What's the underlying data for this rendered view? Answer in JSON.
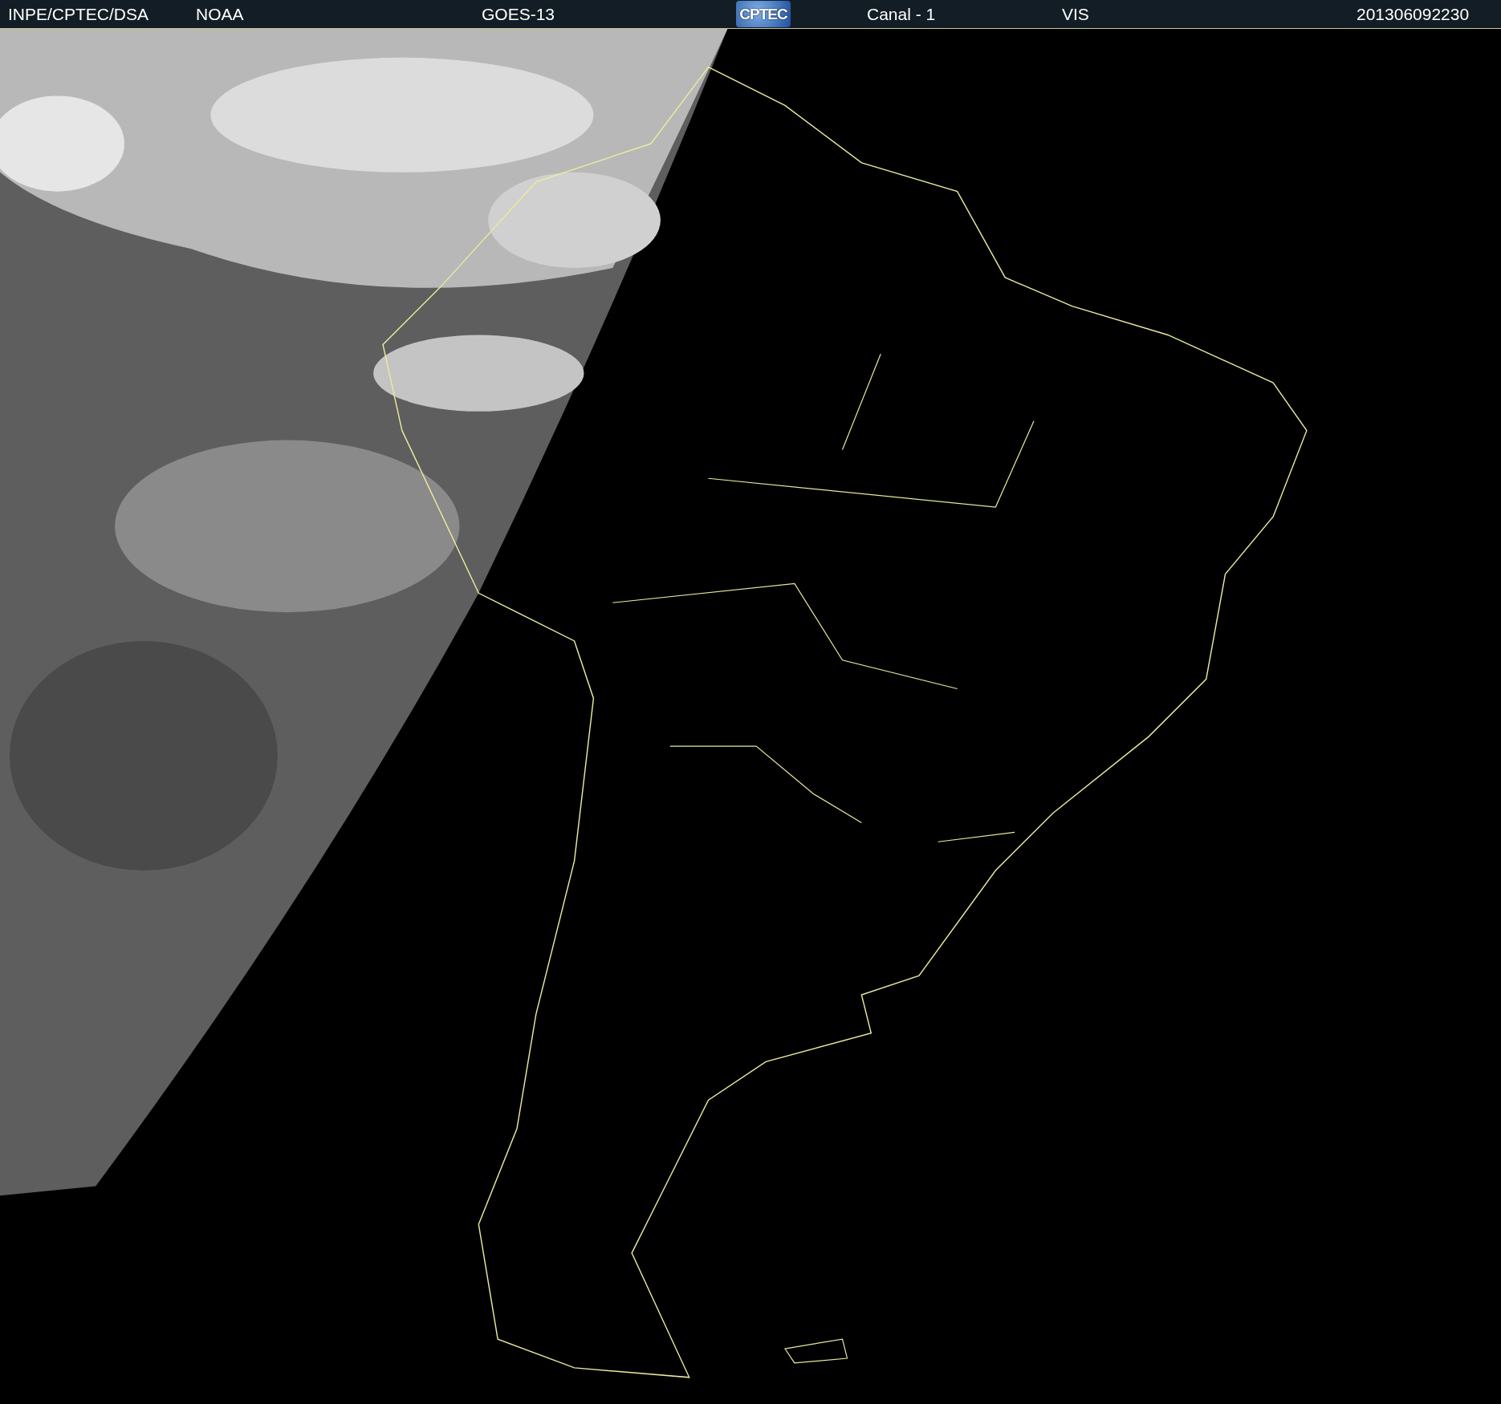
{
  "header": {
    "items": [
      {
        "kind": "text",
        "text": "INPE/CPTEC/DSA"
      },
      {
        "kind": "text",
        "text": "NOAA"
      },
      {
        "kind": "text",
        "text": "GOES-13"
      },
      {
        "kind": "logo",
        "text": "CPTEC"
      },
      {
        "kind": "text",
        "text": "Canal - 1"
      },
      {
        "kind": "text",
        "text": "VIS"
      },
      {
        "kind": "text",
        "text": "201306092230"
      }
    ]
  }
}
